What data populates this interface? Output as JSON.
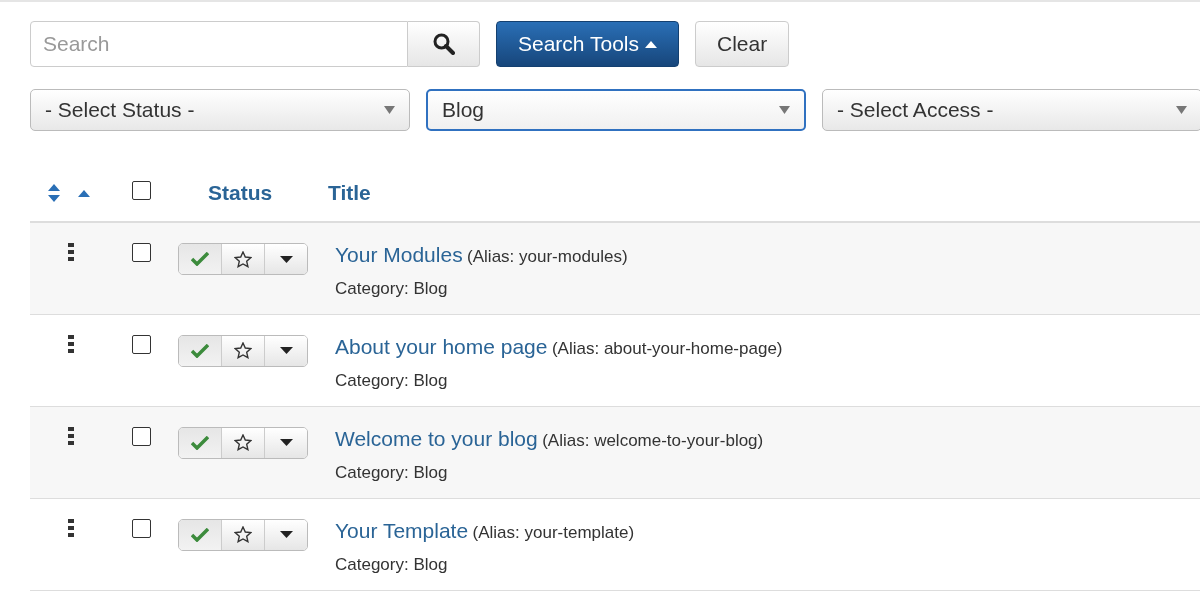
{
  "search": {
    "placeholder": "Search"
  },
  "toolbar_buttons": [
    {
      "label": "Search Tools",
      "kind": "primary"
    },
    {
      "label": "Clear",
      "kind": "default"
    }
  ],
  "filters": [
    {
      "value": "- Select Status -",
      "focused": false
    },
    {
      "value": "Blog",
      "focused": true
    },
    {
      "value": "- Select Access -",
      "focused": false
    }
  ],
  "table": {
    "select_all_checked": false,
    "columns": [
      "Status",
      "Title"
    ],
    "rows": [
      {
        "title": "Your Modules",
        "alias": "(Alias: your-modules)",
        "category": "Category: Blog",
        "checked": false,
        "published": true,
        "featured": false
      },
      {
        "title": "About your home page",
        "alias": "(Alias: about-your-home-page)",
        "category": "Category: Blog",
        "checked": false,
        "published": true,
        "featured": false
      },
      {
        "title": "Welcome to your blog",
        "alias": "(Alias: welcome-to-your-blog)",
        "category": "Category: Blog",
        "checked": false,
        "published": true,
        "featured": false
      },
      {
        "title": "Your Template",
        "alias": "(Alias: your-template)",
        "category": "Category: Blog",
        "checked": false,
        "published": true,
        "featured": false
      }
    ]
  }
}
